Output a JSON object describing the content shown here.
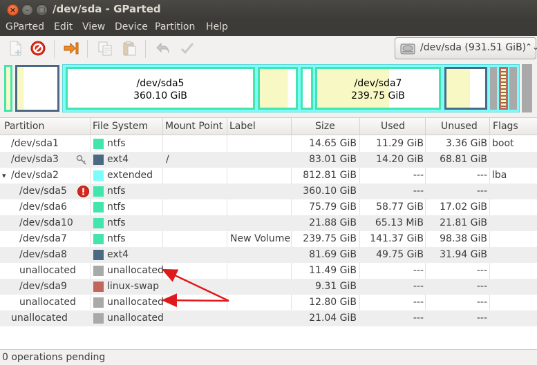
{
  "window": {
    "title": "/dev/sda - GParted"
  },
  "menubar": [
    "GParted",
    "Edit",
    "View",
    "Device",
    "Partition",
    "Help"
  ],
  "toolbar": {
    "icons": [
      "new-icon",
      "delete-icon",
      "resize-move-icon",
      "copy-icon",
      "paste-icon",
      "undo-icon",
      "apply-icon"
    ]
  },
  "device_selector": {
    "device": "/dev/sda",
    "size": "(931.51 GiB)",
    "label": "/dev/sda  (931.51 GiB)"
  },
  "diskmap": {
    "sda5": {
      "name": "/dev/sda5",
      "size": "360.10 GiB"
    },
    "sda7": {
      "name": "/dev/sda7",
      "size": "239.75 GiB"
    }
  },
  "columns": [
    "Partition",
    "File System",
    "Mount Point",
    "Label",
    "Size",
    "Used",
    "Unused",
    "Flags"
  ],
  "rows": [
    {
      "partition": "/dev/sda1",
      "fs": "ntfs",
      "color": "#42e5ac",
      "mount": "",
      "label": "",
      "size": "14.65 GiB",
      "used": "11.29 GiB",
      "unused": "3.36 GiB",
      "flags": "boot",
      "indent": 0,
      "icon": ""
    },
    {
      "partition": "/dev/sda3",
      "fs": "ext4",
      "color": "#4b6983",
      "mount": "/",
      "label": "",
      "size": "83.01 GiB",
      "used": "14.20 GiB",
      "unused": "68.81 GiB",
      "flags": "",
      "indent": 0,
      "icon": "key-icon"
    },
    {
      "partition": "/dev/sda2",
      "fs": "extended",
      "color": "#7dfcfe",
      "mount": "",
      "label": "",
      "size": "812.81 GiB",
      "used": "---",
      "unused": "---",
      "flags": "lba",
      "indent": 0,
      "icon": "",
      "expander": "▾"
    },
    {
      "partition": "/dev/sda5",
      "fs": "ntfs",
      "color": "#42e5ac",
      "mount": "",
      "label": "",
      "size": "360.10 GiB",
      "used": "---",
      "unused": "---",
      "flags": "",
      "indent": 1,
      "icon": "error-icon"
    },
    {
      "partition": "/dev/sda6",
      "fs": "ntfs",
      "color": "#42e5ac",
      "mount": "",
      "label": "",
      "size": "75.79 GiB",
      "used": "58.77 GiB",
      "unused": "17.02 GiB",
      "flags": "",
      "indent": 1,
      "icon": ""
    },
    {
      "partition": "/dev/sda10",
      "fs": "ntfs",
      "color": "#42e5ac",
      "mount": "",
      "label": "",
      "size": "21.88 GiB",
      "used": "65.13 MiB",
      "unused": "21.81 GiB",
      "flags": "",
      "indent": 1,
      "icon": ""
    },
    {
      "partition": "/dev/sda7",
      "fs": "ntfs",
      "color": "#42e5ac",
      "mount": "",
      "label": "New Volume",
      "size": "239.75 GiB",
      "used": "141.37 GiB",
      "unused": "98.38 GiB",
      "flags": "",
      "indent": 1,
      "icon": ""
    },
    {
      "partition": "/dev/sda8",
      "fs": "ext4",
      "color": "#4b6983",
      "mount": "",
      "label": "",
      "size": "81.69 GiB",
      "used": "49.75 GiB",
      "unused": "31.94 GiB",
      "flags": "",
      "indent": 1,
      "icon": ""
    },
    {
      "partition": "unallocated",
      "fs": "unallocated",
      "color": "#a9a9a9",
      "mount": "",
      "label": "",
      "size": "11.49 GiB",
      "used": "---",
      "unused": "---",
      "flags": "",
      "indent": 1,
      "icon": ""
    },
    {
      "partition": "/dev/sda9",
      "fs": "linux-swap",
      "color": "#c1665a",
      "mount": "",
      "label": "",
      "size": "9.31 GiB",
      "used": "---",
      "unused": "---",
      "flags": "",
      "indent": 1,
      "icon": ""
    },
    {
      "partition": "unallocated",
      "fs": "unallocated",
      "color": "#a9a9a9",
      "mount": "",
      "label": "",
      "size": "12.80 GiB",
      "used": "---",
      "unused": "---",
      "flags": "",
      "indent": 1,
      "icon": ""
    },
    {
      "partition": "unallocated",
      "fs": "unallocated",
      "color": "#a9a9a9",
      "mount": "",
      "label": "",
      "size": "21.04 GiB",
      "used": "---",
      "unused": "---",
      "flags": "",
      "indent": 0,
      "icon": ""
    }
  ],
  "status": {
    "text": "0 operations pending"
  },
  "colors": {
    "titlebar": "#3c3b37",
    "extended": "#7dfcfe",
    "ntfs": "#42e5ac",
    "ext4": "#4b6983",
    "unallocated": "#a9a9a9",
    "linux_swap": "#c1665a",
    "used": "#f8f8c4",
    "annotation_arrow": "#e0191b"
  }
}
